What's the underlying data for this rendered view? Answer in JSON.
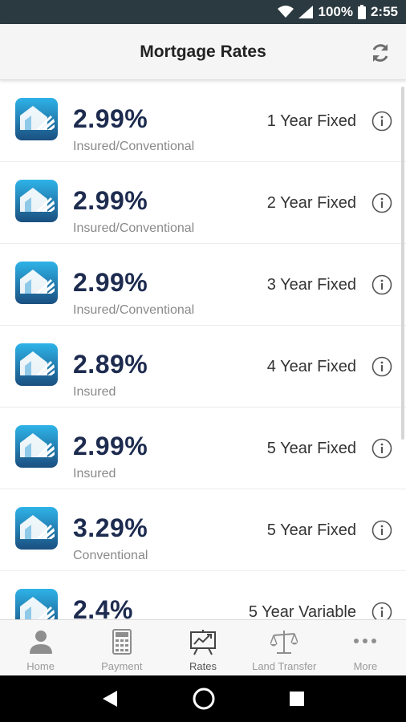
{
  "status_bar": {
    "battery": "100%",
    "time": "2:55"
  },
  "app_bar": {
    "title": "Mortgage Rates",
    "refresh_icon": "refresh-icon"
  },
  "rates": [
    {
      "rate": "2.99%",
      "type": "Insured/Conventional",
      "term": "1 Year Fixed"
    },
    {
      "rate": "2.99%",
      "type": "Insured/Conventional",
      "term": "2 Year Fixed"
    },
    {
      "rate": "2.99%",
      "type": "Insured/Conventional",
      "term": "3 Year Fixed"
    },
    {
      "rate": "2.89%",
      "type": "Insured",
      "term": "4 Year Fixed"
    },
    {
      "rate": "2.99%",
      "type": "Insured",
      "term": "5 Year Fixed"
    },
    {
      "rate": "3.29%",
      "type": "Conventional",
      "term": "5 Year Fixed"
    },
    {
      "rate": "2.4%",
      "type": "",
      "term": "5 Year Variable"
    }
  ],
  "bottom_nav": [
    {
      "label": "Home",
      "icon": "person-icon",
      "active": false
    },
    {
      "label": "Payment",
      "icon": "calculator-icon",
      "active": false
    },
    {
      "label": "Rates",
      "icon": "chart-board-icon",
      "active": true
    },
    {
      "label": "Land Transfer",
      "icon": "scales-icon",
      "active": false
    },
    {
      "label": "More",
      "icon": "more-dots-icon",
      "active": false
    }
  ],
  "colors": {
    "status_bar": "#2b3a41",
    "rate_text": "#1d2b4f",
    "logo_gradient_top": "#29a9e0",
    "logo_gradient_bottom": "#1b4a78"
  }
}
